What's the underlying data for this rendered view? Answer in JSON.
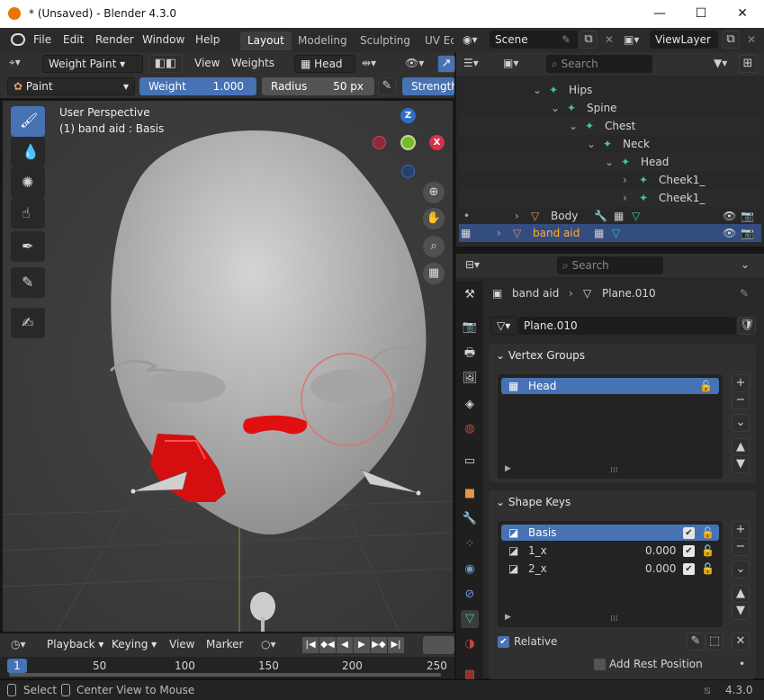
{
  "window": {
    "title": "* (Unsaved) - Blender 4.3.0",
    "minimize": "—",
    "maximize": "☐",
    "close": "✕"
  },
  "menu": {
    "file": "File",
    "edit": "Edit",
    "render": "Render",
    "window": "Window",
    "help": "Help"
  },
  "workspaces": [
    "Layout",
    "Modeling",
    "Sculpting",
    "UV Ed"
  ],
  "scene": {
    "name": "Scene",
    "view_layer": "ViewLayer"
  },
  "viewport_header": {
    "mode": "Weight Paint",
    "view": "View",
    "weights": "Weights",
    "vertex_group": "Head"
  },
  "tool_settings": {
    "brush": "Paint",
    "weight_label": "Weight",
    "weight_value": "1.000",
    "radius_label": "Radius",
    "radius_value": "50 px",
    "strength_label": "Strength"
  },
  "viewport": {
    "perspective": "User Perspective",
    "object_info": "(1) band aid : Basis",
    "axis_x": "X",
    "axis_y": "Y",
    "axis_z": "Z"
  },
  "outliner": {
    "search_placeholder": "Search",
    "rows": [
      "Hips",
      "Spine",
      "Chest",
      "Neck",
      "Head",
      "Cheek1_",
      "Cheek1_",
      "Body",
      "band aid"
    ]
  },
  "properties": {
    "search_placeholder": "Search",
    "breadcrumb_object": "band aid",
    "breadcrumb_mesh": "Plane.010",
    "mesh_name": "Plane.010",
    "vertex_groups": {
      "title": "Vertex Groups",
      "items": [
        "Head"
      ]
    },
    "shape_keys": {
      "title": "Shape Keys",
      "items": [
        {
          "name": "Basis",
          "value": ""
        },
        {
          "name": "1_x",
          "value": "0.000"
        },
        {
          "name": "2_x",
          "value": "0.000"
        }
      ],
      "relative": "Relative",
      "add_rest": "Add Rest Position"
    }
  },
  "timeline": {
    "playback": "Playback",
    "keying": "Keying",
    "view": "View",
    "marker": "Marker",
    "current_frame": "1",
    "ticks": [
      "50",
      "100",
      "150",
      "200",
      "250"
    ]
  },
  "statusbar": {
    "select": "Select",
    "center": "Center View to Mouse",
    "version": "4.3.0"
  },
  "colors": {
    "accent": "#4772b3",
    "bandaid": "#e01010",
    "bone": "#3fc5a8"
  }
}
